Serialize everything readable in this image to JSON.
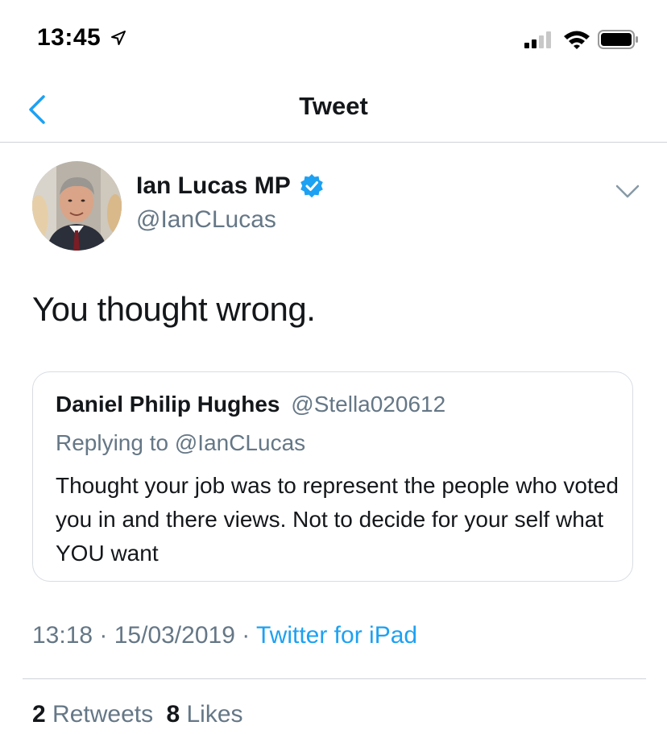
{
  "status_bar": {
    "time": "13:45",
    "icons": [
      "location-arrow-icon",
      "cellular-signal-icon",
      "wifi-icon",
      "battery-icon"
    ]
  },
  "nav": {
    "title": "Tweet",
    "back_icon": "chevron-left-icon"
  },
  "tweet": {
    "author_name": "Ian Lucas MP",
    "author_handle": "@IanCLucas",
    "verified": true,
    "text": "You thought wrong.",
    "timestamp": "13:18 · 15/03/2019 · ",
    "source": "Twitter for iPad",
    "retweets_count": "2",
    "retweets_label": "Retweets",
    "likes_count": "8",
    "likes_label": "Likes"
  },
  "quoted_tweet": {
    "author_name": "Daniel Philip Hughes",
    "author_handle": "@Stella020612",
    "replying_to": "Replying to @IanCLucas",
    "text": "Thought your job was to represent the people who voted you in and there views. Not to decide for your self what YOU want"
  },
  "colors": {
    "accent": "#1da1f2",
    "secondary_text": "#657786",
    "primary_text": "#14171a",
    "border": "#cdd3d8"
  }
}
